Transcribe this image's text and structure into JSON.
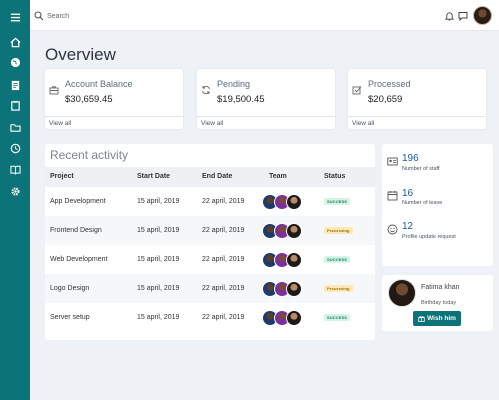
{
  "sidebar": {
    "items": [
      {
        "icon": "menu-icon"
      },
      {
        "icon": "home-icon"
      },
      {
        "icon": "globe-icon"
      },
      {
        "icon": "document-icon"
      },
      {
        "icon": "clipboard-icon"
      },
      {
        "icon": "folder-icon"
      },
      {
        "icon": "clock-icon"
      },
      {
        "icon": "book-icon"
      },
      {
        "icon": "gear-icon"
      }
    ],
    "color": "#0c7478"
  },
  "topbar": {
    "search_placeholder": "Search"
  },
  "overview": {
    "title": "Overview",
    "cards": [
      {
        "label": "Account Balance",
        "value": "$30,659.45",
        "link": "View all",
        "icon": "briefcase-icon"
      },
      {
        "label": "Pending",
        "value": "$19,500.45",
        "link": "View all",
        "icon": "refresh-icon"
      },
      {
        "label": "Processed",
        "value": "$20,659",
        "link": "View all",
        "icon": "checkbox-icon"
      }
    ]
  },
  "activity": {
    "title": "Recent activity",
    "columns": [
      "Project",
      "Start Date",
      "End Date",
      "Team",
      "Status"
    ],
    "rows": [
      {
        "project": "App Development",
        "start": "15 april, 2019",
        "end": "22 april, 2019",
        "status": "SUCCESS",
        "status_type": "success"
      },
      {
        "project": "Frontend Design",
        "start": "15 april, 2019",
        "end": "22 april, 2019",
        "status": "Processing",
        "status_type": "processing"
      },
      {
        "project": "Web Development",
        "start": "15 april, 2019",
        "end": "22 april, 2019",
        "status": "SUCCESS",
        "status_type": "success"
      },
      {
        "project": "Logo Design",
        "start": "15 april, 2019",
        "end": "22 april, 2019",
        "status": "Processing",
        "status_type": "processing"
      },
      {
        "project": "Server setup",
        "start": "15 april, 2019",
        "end": "22 april, 2019",
        "status": "SUCCESS",
        "status_type": "success"
      }
    ]
  },
  "stats": [
    {
      "value": "196",
      "label": "Number of staff",
      "icon": "id-card-icon"
    },
    {
      "value": "16",
      "label": "Number of leave",
      "icon": "calendar-icon"
    },
    {
      "value": "12",
      "label": "Profile update request",
      "icon": "smiley-icon"
    }
  ],
  "birthday": {
    "name": "Fatima khan",
    "subtitle": "Birthday today",
    "button": "Wish him"
  },
  "colors": {
    "accent": "#0c7478",
    "success_bg": "#d4f5e6",
    "processing_bg": "#fde9b8",
    "stat_number": "#1e5a9a"
  }
}
